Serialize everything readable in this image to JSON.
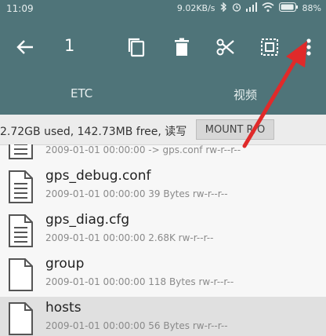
{
  "status_bar": {
    "time": "11:09",
    "network_speed": "9.02KB/s",
    "battery": "88%"
  },
  "toolbar": {
    "selection_count": "1",
    "icons": [
      "back-arrow-icon",
      "copy-icon",
      "delete-icon",
      "cut-icon",
      "select-all-icon",
      "more-vert-icon"
    ]
  },
  "tabs": [
    {
      "label": "ETC"
    },
    {
      "label": "视频"
    }
  ],
  "storage": {
    "info": "2.72GB used, 142.73MB free, 读写",
    "mount_label": "MOUNT R/O"
  },
  "files": [
    {
      "name": "",
      "meta": "2009-01-01 00:00:00 -> gps.conf rw-r--r--",
      "icon": "document-icon",
      "selected": false
    },
    {
      "name": "gps_debug.conf",
      "meta": "2009-01-01 00:00:00 39 Bytes rw-r--r--",
      "icon": "document-icon",
      "selected": false
    },
    {
      "name": "gps_diag.cfg",
      "meta": "2009-01-01 00:00:00 2.68K rw-r--r--",
      "icon": "document-icon",
      "selected": false
    },
    {
      "name": "group",
      "meta": "2009-01-01 00:00:00 118 Bytes rw-r--r--",
      "icon": "blank-file-icon",
      "selected": false
    },
    {
      "name": "hosts",
      "meta": "2009-01-01 00:00:00 56 Bytes rw-r--r--",
      "icon": "blank-file-icon",
      "selected": true
    }
  ],
  "colors": {
    "primary": "#4f7479",
    "annotation_arrow": "#e02a2a",
    "selected_row": "#e0e0e0"
  }
}
